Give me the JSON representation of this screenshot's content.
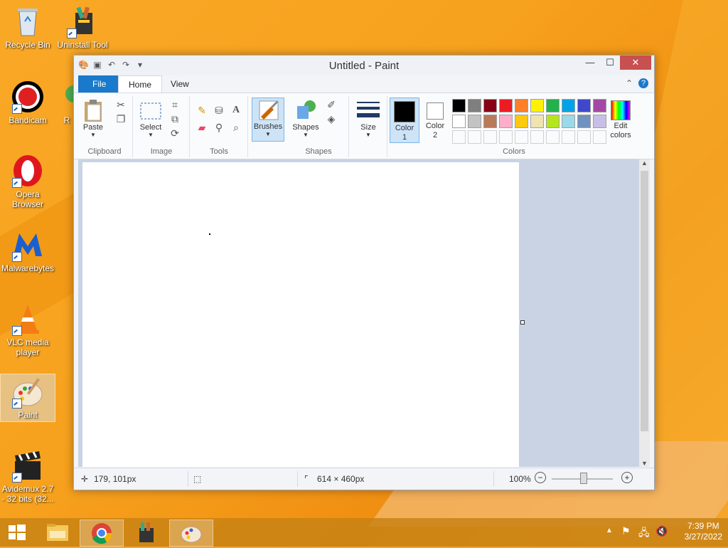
{
  "desktop_icons": [
    {
      "label": "Recycle Bin"
    },
    {
      "label": "Uninstall Tool"
    },
    {
      "label": "Bandicam"
    },
    {
      "label": "R"
    },
    {
      "label": "Opera Browser"
    },
    {
      "label": "Malwarebytes"
    },
    {
      "label": "VLC media player"
    },
    {
      "label": "Paint"
    },
    {
      "label": "Avidemux 2.7 - 32 bits (32..."
    }
  ],
  "window": {
    "title": "Untitled - Paint",
    "tabs": {
      "file": "File",
      "home": "Home",
      "view": "View"
    },
    "help_icon": "?"
  },
  "ribbon": {
    "clipboard": {
      "label": "Clipboard",
      "paste": "Paste"
    },
    "image": {
      "label": "Image",
      "select": "Select"
    },
    "tools": {
      "label": "Tools"
    },
    "brushes": {
      "label": "Brushes"
    },
    "shapes": {
      "label": "Shapes",
      "shapes_btn": "Shapes"
    },
    "size": {
      "label": "Size"
    },
    "colors": {
      "label": "Colors",
      "color1": "Color\n1",
      "color1_line1": "Color",
      "color1_line2": "1",
      "color2_line1": "Color",
      "color2_line2": "2",
      "edit_line1": "Edit",
      "edit_line2": "colors",
      "palette_row1": [
        "#000000",
        "#7f7f7f",
        "#880015",
        "#ed1c24",
        "#ff7f27",
        "#fff200",
        "#22b14c",
        "#00a2e8",
        "#3f48cc",
        "#a349a4"
      ],
      "palette_row2": [
        "#ffffff",
        "#c3c3c3",
        "#b97a57",
        "#ffaec9",
        "#ffc90e",
        "#efe4b0",
        "#b5e61d",
        "#99d9ea",
        "#7092be",
        "#c8bfe7"
      ]
    }
  },
  "status": {
    "cursor_pos": "179, 101px",
    "canvas_size": "614 × 460px",
    "zoom": "100%"
  },
  "taskbar": {
    "time": "7:39 PM",
    "date": "3/27/2022"
  },
  "colors": {
    "accent": "#1979ca",
    "close": "#c75050"
  }
}
